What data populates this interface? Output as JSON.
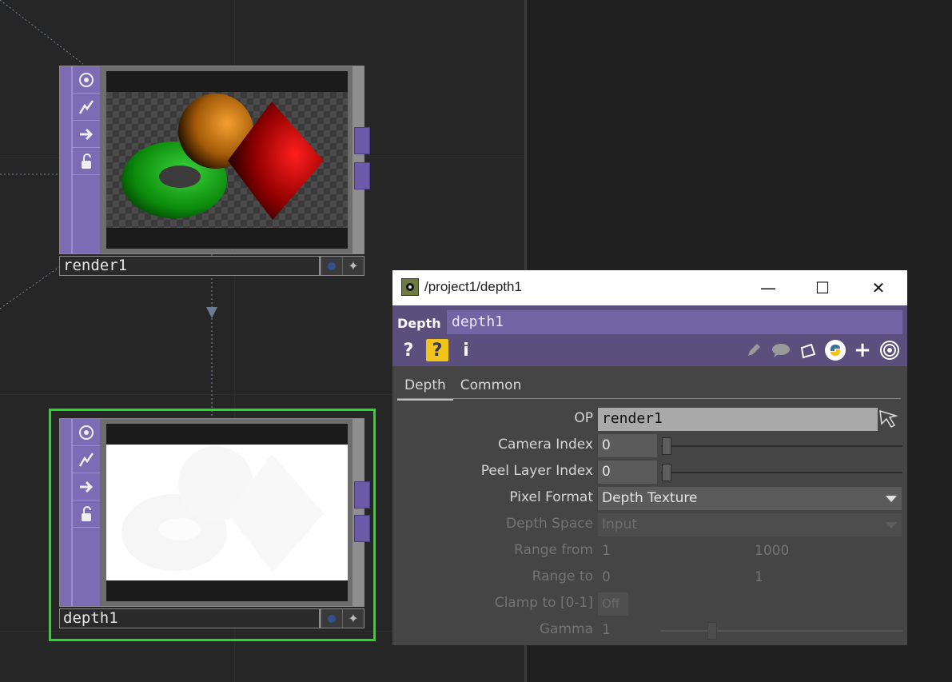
{
  "nodes": {
    "render1": {
      "label": "render1"
    },
    "depth1": {
      "label": "depth1"
    }
  },
  "window": {
    "title": "/project1/depth1",
    "minimize_glyph": "—",
    "maximize_glyph": "☐",
    "close_glyph": "✕"
  },
  "operator": {
    "type": "Depth",
    "name": "depth1"
  },
  "tabs": [
    "Depth",
    "Common"
  ],
  "params": {
    "op": {
      "label": "OP",
      "value": "render1"
    },
    "camera_index": {
      "label": "Camera Index",
      "value": "0",
      "level": 0
    },
    "peel_layer_index": {
      "label": "Peel Layer Index",
      "value": "0",
      "level": 0
    },
    "pixel_format": {
      "label": "Pixel Format",
      "value": "Depth Texture"
    },
    "depth_space": {
      "label": "Depth Space",
      "value": "Input"
    },
    "range_from": {
      "label": "Range from",
      "value1": "1",
      "value2": "1000"
    },
    "range_to": {
      "label": "Range to",
      "value1": "0",
      "value2": "1"
    },
    "clamp": {
      "label": "Clamp to [0-1]",
      "value": "Off"
    },
    "gamma": {
      "label": "Gamma",
      "value": "1",
      "level": 0.2
    }
  },
  "colors": {
    "selected_outline": "#22dd22",
    "operator_bar": "#5a4f7d",
    "node_side": "#7b6cb5"
  },
  "icons": [
    "viewer-icon",
    "bypass-icon",
    "cook-icon",
    "lock-icon",
    "help-icon",
    "python-help-icon",
    "info-icon",
    "edit-icon",
    "comment-icon",
    "clipboard-icon",
    "python-icon",
    "plus-icon",
    "target-icon"
  ]
}
